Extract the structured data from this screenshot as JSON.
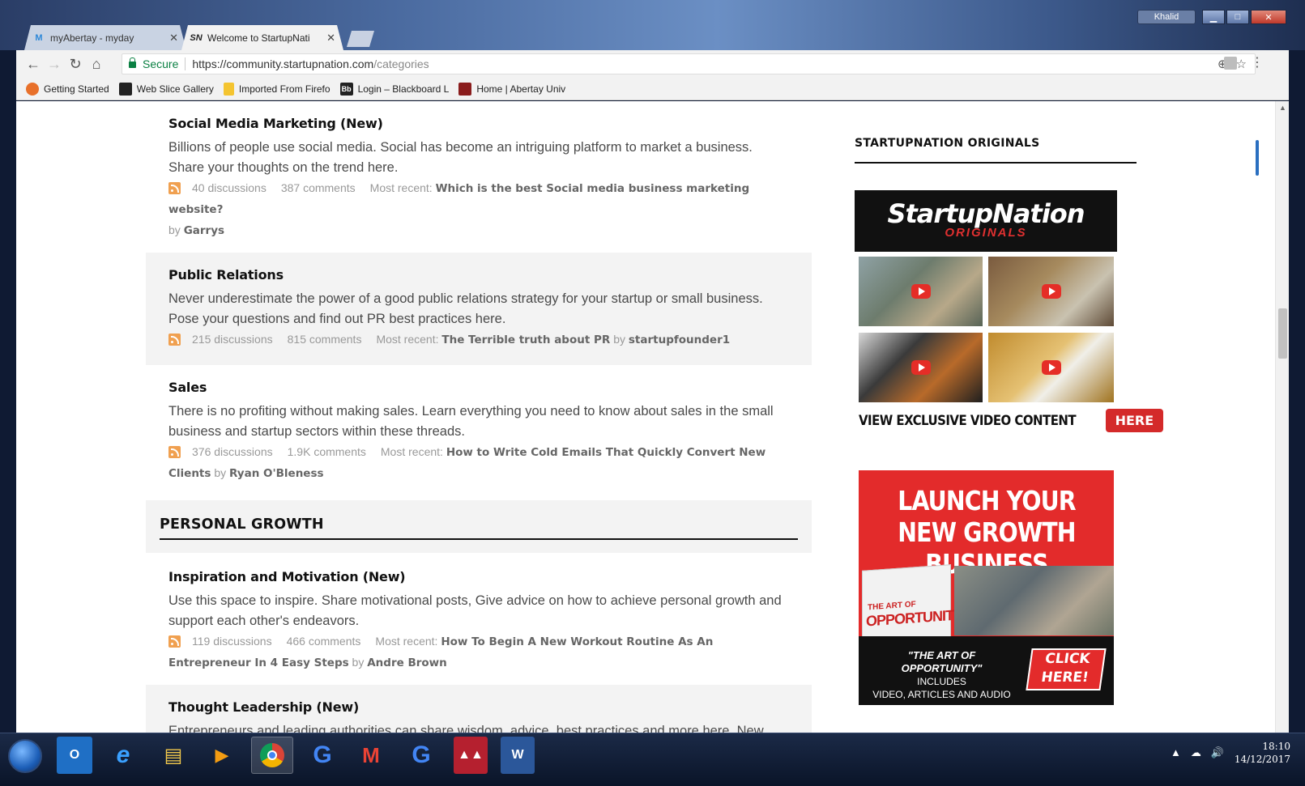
{
  "browser": {
    "tabs": [
      {
        "label": "myAbertay - myday",
        "favicon": "M"
      },
      {
        "label": "Welcome to StartupNati",
        "favicon": "SN"
      }
    ],
    "user": "Khalid",
    "secure_label": "Secure",
    "url_host": "https://community.startupnation.com",
    "url_path": "/categories",
    "bookmarks": [
      {
        "label": "Getting Started",
        "icon_color": "#e8702a"
      },
      {
        "label": "Web Slice Gallery",
        "icon_color": "#222222"
      },
      {
        "label": "Imported From Firefo",
        "icon_color": "#f4c430"
      },
      {
        "label": "Login – Blackboard L",
        "icon_color": "#222222",
        "icon_text": "Bb"
      },
      {
        "label": "Home | Abertay Univ",
        "icon_color": "#8a1c1c"
      }
    ]
  },
  "categories": [
    {
      "title": "Social Media Marketing (New)",
      "description": "Billions of people use social media. Social has become an intriguing platform to market a business. Share your thoughts on the trend here.",
      "discussions": "40 discussions",
      "comments": "387 comments",
      "recent_label": "Most recent:",
      "recent_title": "Which is the best Social media business marketing website?",
      "by_label": "by",
      "author": "Garrys"
    },
    {
      "title": "Public Relations",
      "description": "Never underestimate the power of a good public relations strategy for your startup or small business. Pose your questions and find out PR best practices here.",
      "discussions": "215 discussions",
      "comments": "815 comments",
      "recent_label": "Most recent:",
      "recent_title": "The Terrible truth about PR",
      "by_label": "by",
      "author": "startupfounder1"
    },
    {
      "title": "Sales",
      "description": "There is no profiting without making sales. Learn everything you need to know about sales in the small business and startup sectors within these threads.",
      "discussions": "376 discussions",
      "comments": "1.9K comments",
      "recent_label": "Most recent:",
      "recent_title": "How to Write Cold Emails That Quickly Convert New Clients",
      "by_label": "by",
      "author": "Ryan O'Bleness"
    }
  ],
  "section": {
    "title": "PERSONAL GROWTH"
  },
  "categories2": [
    {
      "title": "Inspiration and Motivation (New)",
      "description": "Use this space to inspire. Share motivational posts, Give advice on how to achieve personal growth and support each other's endeavors.",
      "discussions": "119 discussions",
      "comments": "466 comments",
      "recent_label": "Most recent:",
      "recent_title": "How To Begin A New Workout Routine As An Entrepreneur In 4 Easy Steps",
      "by_label": "by",
      "author": "Andre Brown"
    },
    {
      "title": "Thought Leadership (New)",
      "description": "Entrepreneurs and leading authorities can share wisdom, advice, best practices and more here. New"
    }
  ],
  "sidebar": {
    "title": "STARTUPNATION ORIGINALS",
    "banner_logo": "StartupNation",
    "banner_sub": "ORIGINALS",
    "video_cta": "VIEW EXCLUSIVE VIDEO CONTENT",
    "video_btn": "HERE",
    "ad_headline": "LAUNCH YOUR NEW GROWTH BUSINESS",
    "ad_book_small": "THE ART OF",
    "ad_book_big": "OPPORTUNITY",
    "ad_quote": "\"THE ART OF OPPORTUNITY\"",
    "ad_includes": "INCLUDES",
    "ad_detail": "VIDEO, ARTICLES AND AUDIO",
    "ad_click": "CLICK",
    "ad_here": "HERE!"
  },
  "taskbar": {
    "time": "18:10",
    "date": "14/12/2017"
  },
  "colors": {
    "accent_red": "#e32b2b",
    "rss_orange": "#f0a050",
    "secure_green": "#0b8043"
  }
}
